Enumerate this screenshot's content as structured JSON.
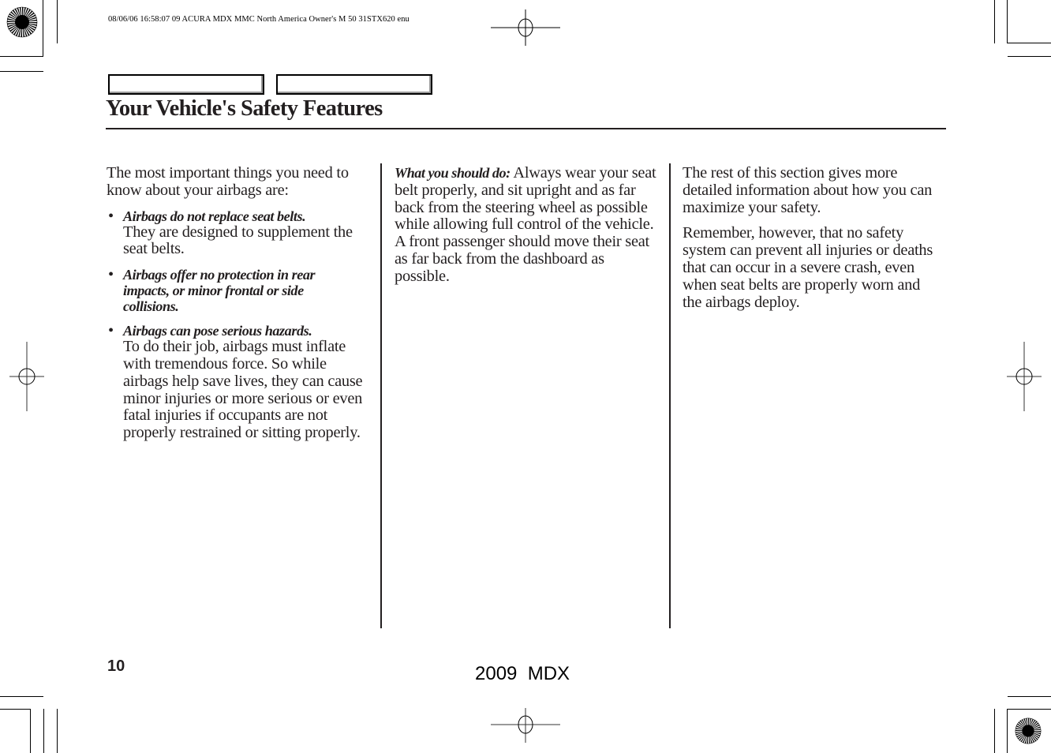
{
  "print_meta": {
    "text": "08/06/06 16:58:07    09 ACURA MDX MMC North America Owner's M 50 31STX620 enu"
  },
  "header": {
    "tabs": [
      "",
      ""
    ],
    "title": "Your Vehicle's Safety Features"
  },
  "columns": {
    "left": {
      "intro": "The most important things you need to know about your airbags are:",
      "bullets": [
        {
          "bold": "Airbags do not replace seat belts.",
          "text": "They are designed to supplement the seat belts."
        },
        {
          "bold": "Airbags offer no protection in rear impacts, or minor frontal or side collisions.",
          "text": ""
        },
        {
          "bold": "Airbags can pose serious hazards.",
          "text": "To do their job, airbags must inflate with tremendous force. So while airbags help save lives, they can cause minor injuries or more serious or even fatal injuries if occupants are not properly restrained or sitting properly."
        }
      ],
      "bullet_glyph": "•"
    },
    "middle": {
      "lead": "What you should do:",
      "text": " Always wear your seat belt properly, and sit upright and as far back from the steering wheel as possible while allowing full control of the vehicle. A front passenger should move their seat as far back from the dashboard as possible."
    },
    "right": {
      "paragraphs": [
        "The rest of this section gives more detailed information about how you can maximize your safety.",
        "Remember, however, that no safety system can prevent all injuries or deaths that can occur in a severe crash, even when seat belts are properly worn and the airbags deploy."
      ]
    }
  },
  "footer": {
    "page_number": "10",
    "model": "2009  MDX"
  },
  "icons": {
    "registration_mark": "crosshair-circle",
    "color_bar_mark": "sunburst-circle"
  }
}
